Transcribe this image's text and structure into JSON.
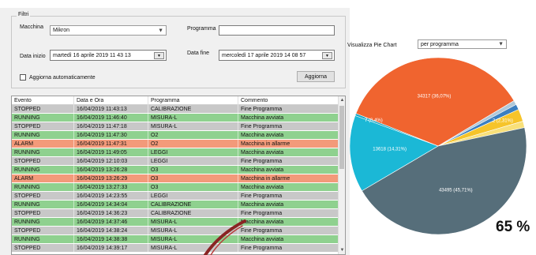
{
  "filters": {
    "title": "Filtri",
    "macchina_label": "Macchina",
    "macchina_value": "Mikron",
    "programma_label": "Programma",
    "programma_value": "",
    "data_inizio_label": "Data inizio",
    "data_inizio_value": "martedì  16   aprile   2019 11 43 13",
    "data_fine_label": "Data fine",
    "data_fine_value": "mercoledì 17   aprile   2019 14 08 57",
    "auto_update_label": "Aggiorna automaticamente",
    "auto_update_checked": false,
    "refresh_button": "Aggiorna"
  },
  "pie_settings": {
    "label": "Visualizza Pie Chart",
    "value": "per programma"
  },
  "grid": {
    "columns": [
      "Evento",
      "Data e Ora",
      "Programma",
      "Commento"
    ],
    "rows": [
      {
        "evento": "STOPPED",
        "data": "16/04/2019 11:43:13",
        "programma": "CALIBRAZIONE",
        "commento": "Fine Programma",
        "color": "#c8c8c8"
      },
      {
        "evento": "RUNNING",
        "data": "16/04/2019 11:46:40",
        "programma": "MISURA-L",
        "commento": "Macchina avviata",
        "color": "#8fd18f"
      },
      {
        "evento": "STOPPED",
        "data": "16/04/2019 11:47:18",
        "programma": "MISURA-L",
        "commento": "Fine Programma",
        "color": "#c8c8c8"
      },
      {
        "evento": "RUNNING",
        "data": "16/04/2019 11:47:30",
        "programma": "O2",
        "commento": "Macchina avviata",
        "color": "#8fd18f"
      },
      {
        "evento": "ALARM",
        "data": "16/04/2019 11:47:31",
        "programma": "O2",
        "commento": "Macchina in allarme",
        "color": "#f39a7a"
      },
      {
        "evento": "RUNNING",
        "data": "16/04/2019 11:49:05",
        "programma": "LEGGI",
        "commento": "Macchina avviata",
        "color": "#8fd18f"
      },
      {
        "evento": "STOPPED",
        "data": "16/04/2019 12:10:03",
        "programma": "LEGGI",
        "commento": "Fine Programma",
        "color": "#c8c8c8"
      },
      {
        "evento": "RUNNING",
        "data": "16/04/2019 13:26:28",
        "programma": "O3",
        "commento": "Macchina avviata",
        "color": "#8fd18f"
      },
      {
        "evento": "ALARM",
        "data": "16/04/2019 13:26:29",
        "programma": "O3",
        "commento": "Macchina in allarme",
        "color": "#f39a7a"
      },
      {
        "evento": "RUNNING",
        "data": "16/04/2019 13:27:33",
        "programma": "O3",
        "commento": "Macchina avviata",
        "color": "#8fd18f"
      },
      {
        "evento": "STOPPED",
        "data": "16/04/2019 14:23:55",
        "programma": "LEGGI",
        "commento": "Fine Programma",
        "color": "#c8c8c8"
      },
      {
        "evento": "RUNNING",
        "data": "16/04/2019 14:34:04",
        "programma": "CALIBRAZIONE",
        "commento": "Macchina avviata",
        "color": "#8fd18f"
      },
      {
        "evento": "STOPPED",
        "data": "16/04/2019 14:36:23",
        "programma": "CALIBRAZIONE",
        "commento": "Fine Programma",
        "color": "#c8c8c8"
      },
      {
        "evento": "RUNNING",
        "data": "16/04/2019 14:37:46",
        "programma": "MISURA-L",
        "commento": "Macchina avviata",
        "color": "#8fd18f"
      },
      {
        "evento": "STOPPED",
        "data": "16/04/2019 14:38:24",
        "programma": "MISURA-L",
        "commento": "Fine Programma",
        "color": "#c8c8c8"
      },
      {
        "evento": "RUNNING",
        "data": "16/04/2019 14:38:38",
        "programma": "MISURA-L",
        "commento": "Macchina avviata",
        "color": "#8fd18f"
      },
      {
        "evento": "STOPPED",
        "data": "16/04/2019 14:39:17",
        "programma": "MISURA-L",
        "commento": "Fine Programma",
        "color": "#c8c8c8"
      }
    ]
  },
  "chart_data": {
    "type": "pie",
    "slices": [
      {
        "label": "34317 (36,07%)",
        "value": 36.07,
        "color": "#f0642f"
      },
      {
        "label": "",
        "value": 0.8,
        "color": "#b0c8d8"
      },
      {
        "label": "",
        "value": 1.0,
        "color": "#3a7fc0"
      },
      {
        "label": "2 (2,31%)",
        "value": 2.31,
        "color": "#f6c42a"
      },
      {
        "label": "",
        "value": 1.2,
        "color": "#f8e07a"
      },
      {
        "label": "43495 (45,71%)",
        "value": 45.71,
        "color": "#566e7a"
      },
      {
        "label": "13618 (14,31%)",
        "value": 14.31,
        "color": "#1bb8d6"
      },
      {
        "label": "7 (0,4%)",
        "value": 0.4,
        "color": "#17a7c4"
      }
    ]
  },
  "overlay": {
    "percent_text": "65 %"
  }
}
